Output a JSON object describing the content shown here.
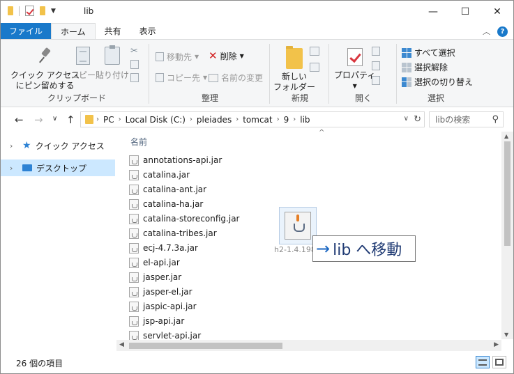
{
  "window": {
    "title": "lib",
    "controls": {
      "minimize": "—",
      "maximize": "☐",
      "close": "✕"
    }
  },
  "ribbon_tabs": [
    "ファイル",
    "ホーム",
    "共有",
    "表示"
  ],
  "ribbon": {
    "clipboard": {
      "pin_label_1": "クイック アクセス",
      "pin_label_2": "にピン留めする",
      "copy": "コピー",
      "paste": "貼り付け",
      "group_label": "クリップボード"
    },
    "organize": {
      "move_to": "移動先",
      "copy_to": "コピー先",
      "delete": "削除",
      "rename": "名前の変更",
      "group_label": "整理"
    },
    "new": {
      "new_folder_1": "新しい",
      "new_folder_2": "フォルダー",
      "group_label": "新規"
    },
    "open": {
      "properties": "プロパティ",
      "group_label": "開く"
    },
    "select": {
      "select_all": "すべて選択",
      "select_none": "選択解除",
      "invert": "選択の切り替え",
      "group_label": "選択"
    }
  },
  "address": {
    "crumbs": [
      "PC",
      "Local Disk (C:)",
      "pleiades",
      "tomcat",
      "9",
      "lib"
    ],
    "search_placeholder": "libの検索"
  },
  "nav_pane": {
    "items": [
      {
        "label": "クイック アクセス",
        "selected": false
      },
      {
        "label": "デスクトップ",
        "selected": true
      }
    ]
  },
  "file_list": {
    "column_name": "名前",
    "files": [
      "annotations-api.jar",
      "catalina.jar",
      "catalina-ant.jar",
      "catalina-ha.jar",
      "catalina-storeconfig.jar",
      "catalina-tribes.jar",
      "ecj-4.7.3a.jar",
      "el-api.jar",
      "jasper.jar",
      "jasper-el.jar",
      "jaspic-api.jar",
      "jsp-api.jar",
      "servlet-api.jar"
    ]
  },
  "drag": {
    "file_name": "h2-1.4.198...",
    "tooltip_arrow": "→",
    "tooltip_text": "lib へ移動"
  },
  "status": {
    "item_count": "26 個の項目"
  },
  "colors": {
    "accent": "#1979ca",
    "selection": "#cce8ff",
    "folder": "#f2c24a",
    "delete_red": "#d11d1d"
  }
}
